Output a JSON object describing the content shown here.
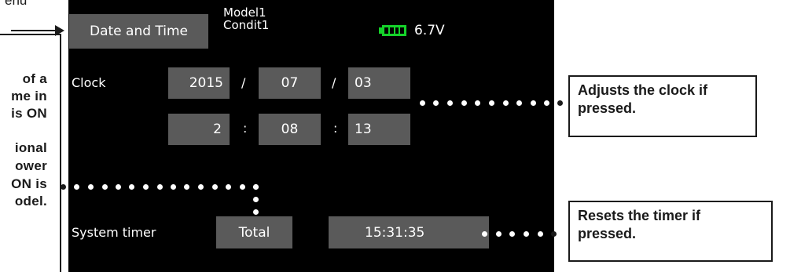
{
  "top_annotation": "enu",
  "left_annotation_lines": [
    "of a",
    "me in",
    "is ON",
    "ional",
    "ower",
    "ON is",
    "odel."
  ],
  "screen": {
    "title_tab": "Date and Time",
    "model_name": "Model1",
    "condition_name": "Condit1",
    "battery_icon": "battery-full-icon",
    "voltage": "6.7V",
    "clock_label": "Clock",
    "date": {
      "year": "2015",
      "sep1": "/",
      "month": "07",
      "sep2": "/",
      "day": "03"
    },
    "time": {
      "hour": "2",
      "sep1": ":",
      "minute": "08",
      "sep2": ":",
      "second": "13"
    },
    "system_timer_label": "System timer",
    "total_button": "Total",
    "timer_value": "15:31:35"
  },
  "callouts": {
    "clock": [
      "Adjusts the clock if",
      "pressed."
    ],
    "timer": [
      "Resets the timer if",
      "pressed."
    ]
  },
  "colors": {
    "screen_bg": "#000000",
    "button_bg": "#5a5a5a",
    "battery": "#15d22a",
    "text": "#ffffff"
  }
}
